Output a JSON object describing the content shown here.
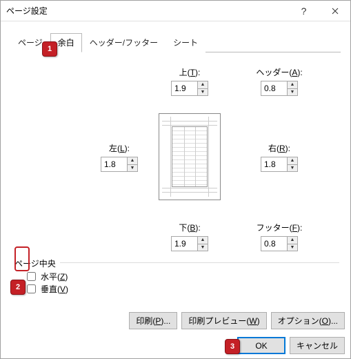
{
  "dialog": {
    "title": "ページ設定"
  },
  "tabs": {
    "page": "ページ",
    "margin": "余白",
    "hf": "ヘッダー/フッター",
    "sheet": "シート"
  },
  "labels": {
    "top_pre": "上(",
    "top_u": "T",
    "top_post": "):",
    "header_pre": "ヘッダー(",
    "header_u": "A",
    "header_post": "):",
    "left_pre": "左(",
    "left_u": "L",
    "left_post": "):",
    "right_pre": "右(",
    "right_u": "R",
    "right_post": "):",
    "bottom_pre": "下(",
    "bottom_u": "B",
    "bottom_post": "):",
    "footer_pre": "フッター(",
    "footer_u": "F",
    "footer_post": "):",
    "center_group": "ページ中央",
    "horiz_pre": "水平(",
    "horiz_u": "Z",
    "horiz_post": ")",
    "vert_pre": "垂直(",
    "vert_u": "V",
    "vert_post": ")"
  },
  "values": {
    "top": "1.9",
    "header": "0.8",
    "left": "1.8",
    "right": "1.8",
    "bottom": "1.9",
    "footer": "0.8"
  },
  "buttons": {
    "print_pre": "印刷(",
    "print_u": "P",
    "print_post": ")...",
    "preview_pre": "印刷プレビュー(",
    "preview_u": "W",
    "preview_post": ")",
    "options_pre": "オプション(",
    "options_u": "O",
    "options_post": ")...",
    "ok": "OK",
    "cancel": "キャンセル"
  },
  "markers": {
    "m1": "1",
    "m2": "2",
    "m3": "3"
  }
}
